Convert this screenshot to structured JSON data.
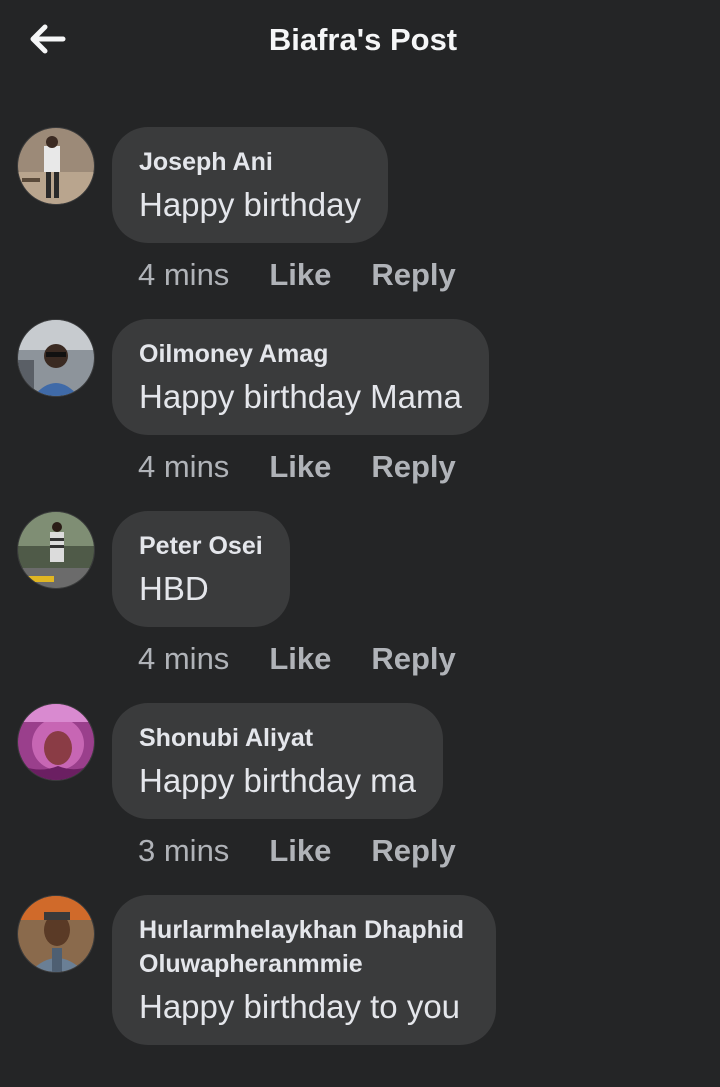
{
  "header": {
    "title": "Biafra's Post",
    "back_icon": "arrow-left-icon"
  },
  "actions": {
    "like_label": "Like",
    "reply_label": "Reply"
  },
  "comments": [
    {
      "author": "Joseph Ani",
      "text": "Happy birthday",
      "time": "4 mins",
      "avatar_color": "#c9b7a3"
    },
    {
      "author": "Oilmoney Amag",
      "text": "Happy birthday Mama",
      "time": "4 mins",
      "avatar_color": "#7a7f86"
    },
    {
      "author": "Peter Osei",
      "text": "HBD",
      "time": "4 mins",
      "avatar_color": "#5b6b55"
    },
    {
      "author": "Shonubi Aliyat",
      "text": "Happy birthday ma",
      "time": "3 mins",
      "avatar_color": "#b04aa0"
    },
    {
      "author": "Hurlarmhelaykhan Dhaphid Oluwapheranmmie",
      "text": "Happy birthday to you",
      "time": "",
      "avatar_color": "#6d7d8e"
    }
  ]
}
